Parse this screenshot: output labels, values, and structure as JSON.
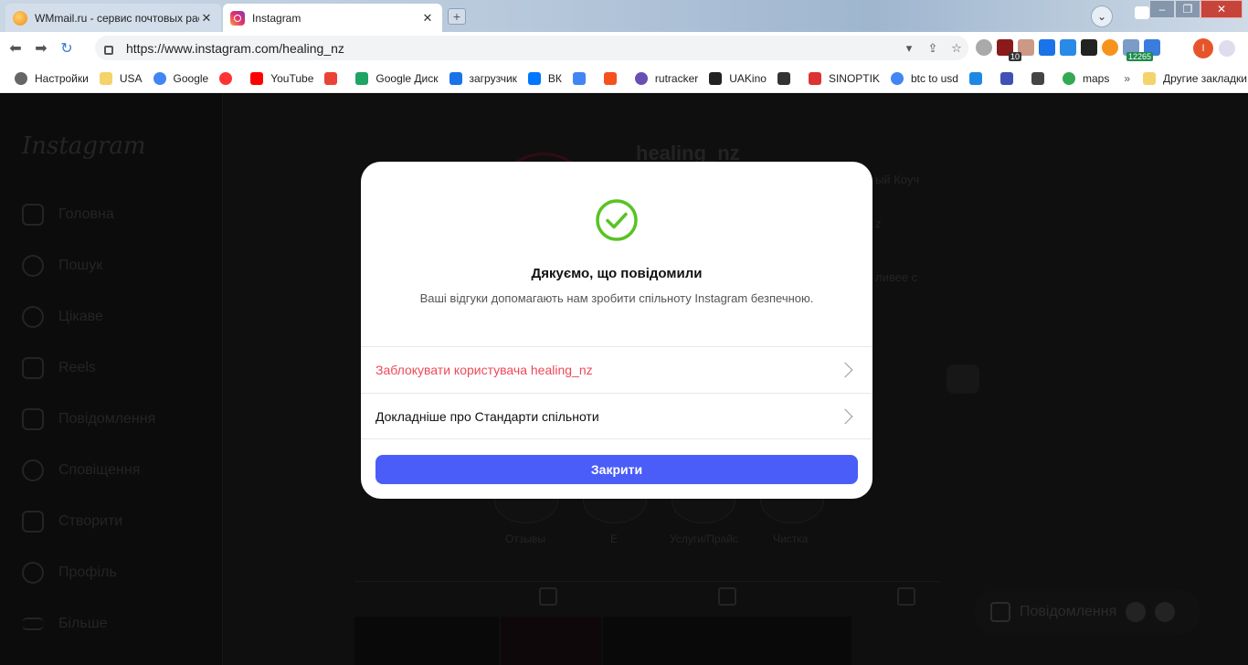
{
  "browser": {
    "tabs": [
      {
        "title": "WMmail.ru - сервис почтовых рас",
        "close": "✕",
        "active": false
      },
      {
        "title": "Instagram",
        "close": "✕",
        "active": true
      }
    ],
    "new_tab": "+",
    "url": "https://www.instagram.com/healing_nz",
    "extension_badges": {
      "counter": "10",
      "coin": "12265"
    },
    "avatar_letter": "I",
    "bookmarks": [
      "Настройки",
      "USA",
      "Google",
      "YouTube",
      "Google Диск",
      "загрузчик",
      "ВК",
      "rutracker",
      "UAKino",
      "SINOPTIK",
      "btc to usd",
      "maps"
    ],
    "bookmarks_more": "»",
    "other_bookmarks": "Другие закладки"
  },
  "instagram": {
    "logo": "Instagram",
    "nav": [
      "Головна",
      "Пошук",
      "Цікаве",
      "Reels",
      "Повідомлення",
      "Сповіщення",
      "Створити",
      "Профіль",
      "Більше"
    ],
    "username": "healing_nz",
    "bio_fragments": [
      "ый Коуч",
      "z",
      "ливее с"
    ],
    "highlights": [
      "Отзывы",
      "Е",
      "Услуги/Прайс",
      "Чистка"
    ],
    "messages_pill": "Повідомлення"
  },
  "modal": {
    "title": "Дякуємо, що повідомили",
    "subtitle": "Ваші відгуки допомагають нам зробити спільноту Instagram безпечною.",
    "block_user": "Заблокувати користувача healing_nz",
    "learn_more": "Докладніше про Стандарти спільноти",
    "close": "Закрити",
    "colors": {
      "success": "#58c322",
      "danger": "#ed4956",
      "primary": "#4a5df9"
    }
  }
}
